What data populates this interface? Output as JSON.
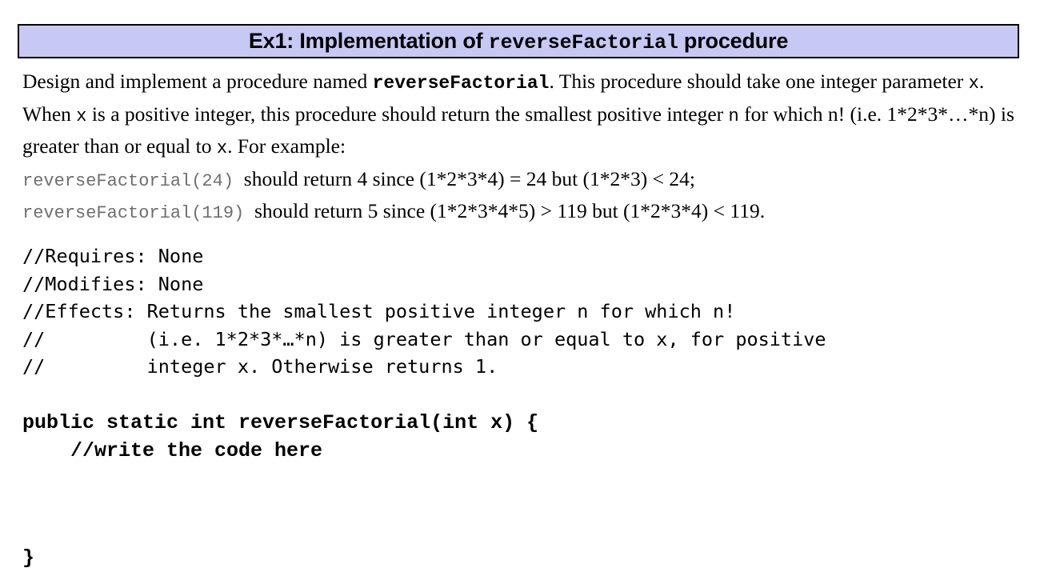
{
  "slide": {
    "background_color": "#ffffff",
    "title": {
      "banner_fill": "#c8c8f4",
      "banner_border_color": "#000000",
      "prefix": "Ex1: Implementation of ",
      "mono_name": "reverseFactorial",
      "suffix": " procedure",
      "full_text": "Ex1: Implementation of reverseFactorial procedure"
    },
    "prose": {
      "s1": "Design and implement a procedure named ",
      "proc_name": "reverseFactorial",
      "s2": ". This procedure should take one integer parameter ",
      "var_x1": "x",
      "s3": ". When ",
      "var_x2": "x",
      "s4": " is a positive integer, this procedure should return the smallest positive integer ",
      "var_n": "n",
      "s5": " for which n! (i.e. 1*2*3*…*n) is greater than or equal to ",
      "var_x3": "x",
      "s6": ". For example:",
      "example1_call": "reverseFactorial(24)",
      "example1_text": "should return 4 since (1*2*3*4) = 24 but (1*2*3) < 24;",
      "example2_call": "reverseFactorial(119)",
      "example2_text": "should return 5 since (1*2*3*4*5) > 119 but (1*2*3*4) < 119."
    },
    "comment_block": {
      "lines": [
        "//Requires: None",
        "//Modifies: None",
        "//Effects: Returns the smallest positive integer n for which n!",
        "//         (i.e. 1*2*3*…*n) is greater than or equal to x, for positive",
        "//         integer x. Otherwise returns 1."
      ],
      "text": "//Requires: None\n//Modifies: None\n//Effects: Returns the smallest positive integer n for which n!\n//         (i.e. 1*2*3*…*n) is greater than or equal to x, for positive\n//         integer x. Otherwise returns 1."
    },
    "code_block": {
      "lines": [
        "public static int reverseFactorial(int x) {",
        "    //write the code here"
      ],
      "text": "public static int reverseFactorial(int x) {\n    //write the code here",
      "closing_brace": "}"
    }
  }
}
